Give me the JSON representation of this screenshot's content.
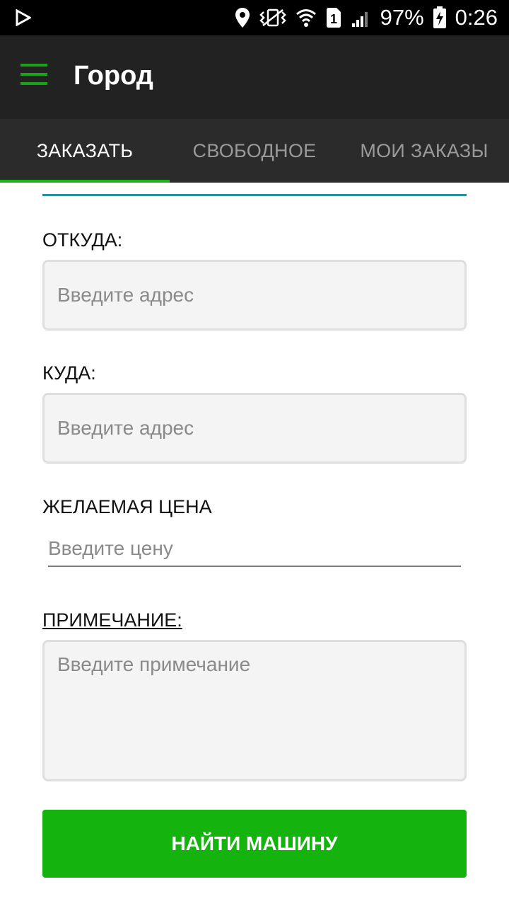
{
  "status_bar": {
    "battery": "97%",
    "time": "0:26",
    "sim_slot": "1",
    "icons": [
      "play-icon",
      "location-icon",
      "vibrate-icon",
      "wifi-icon",
      "sim-icon",
      "signal-icon",
      "battery-charging-icon"
    ]
  },
  "toolbar": {
    "title": "Город",
    "menu_icon": "hamburger-menu-icon",
    "accent_color": "#19a319"
  },
  "tabs": [
    {
      "label": "ЗАКАЗАТЬ",
      "active": true
    },
    {
      "label": "СВОБОДНОЕ",
      "active": false
    },
    {
      "label": "МОИ ЗАКАЗЫ",
      "active": false
    }
  ],
  "form": {
    "from": {
      "label": "ОТКУДА:",
      "value": "",
      "placeholder": "Введите адрес"
    },
    "to": {
      "label": "КУДА:",
      "value": "",
      "placeholder": "Введите адрес"
    },
    "price": {
      "label": "ЖЕЛАЕМАЯ ЦЕНА",
      "value": "",
      "placeholder": "Введите цену"
    },
    "note": {
      "label": "ПРИМЕЧАНИЕ:",
      "value": "",
      "placeholder": "Введите примечание"
    },
    "submit_label": "НАЙТИ МАШИНУ",
    "submit_color": "#14b30e"
  }
}
